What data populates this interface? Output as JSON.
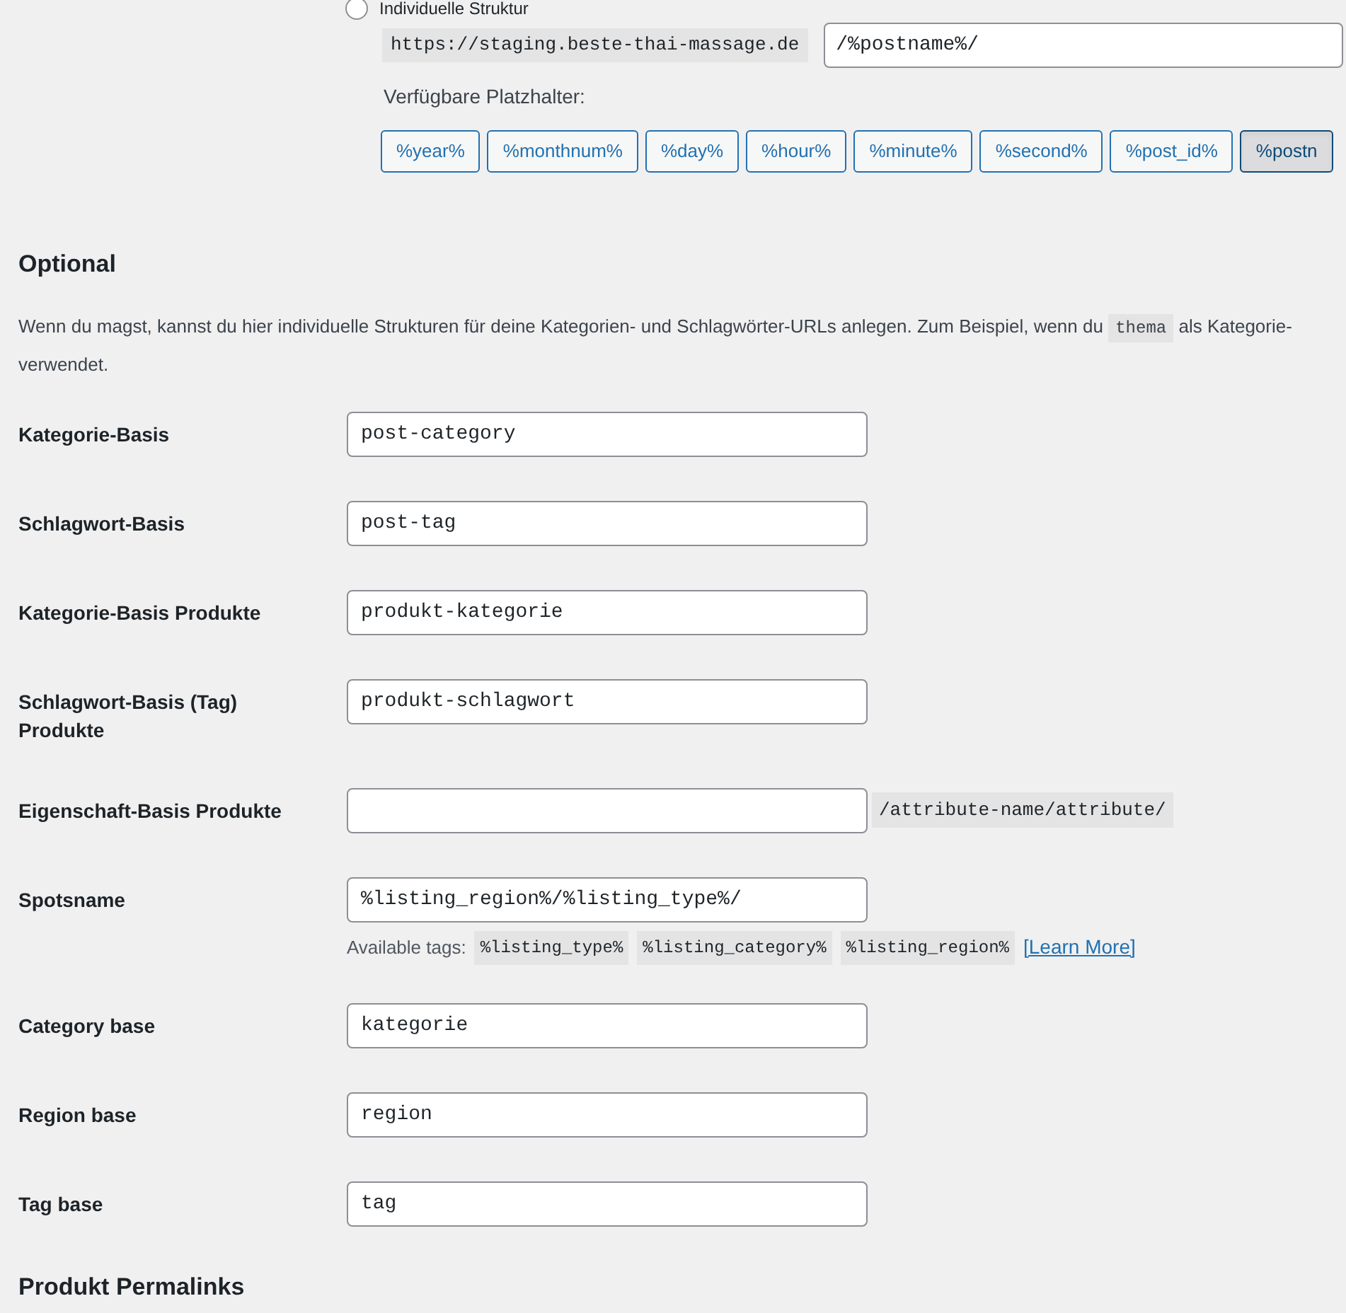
{
  "structure": {
    "radio_label": "Individuelle Struktur",
    "selected": false,
    "base_url": "https://staging.beste-thai-massage.de",
    "value": "/%postname%/",
    "placeholders_label": "Verfügbare Platzhalter:",
    "placeholders": [
      {
        "label": "%year%",
        "selected": false
      },
      {
        "label": "%monthnum%",
        "selected": false
      },
      {
        "label": "%day%",
        "selected": false
      },
      {
        "label": "%hour%",
        "selected": false
      },
      {
        "label": "%minute%",
        "selected": false
      },
      {
        "label": "%second%",
        "selected": false
      },
      {
        "label": "%post_id%",
        "selected": false
      },
      {
        "label": "%postn",
        "selected": true
      }
    ]
  },
  "optional": {
    "title": "Optional",
    "description": [
      {
        "kind": "text",
        "text": "Wenn du magst, kannst du hier individuelle Strukturen für deine Kategorien- und Schlagwörter-URLs anlegen. Zum Beispiel, wenn du"
      },
      {
        "kind": "code",
        "text": "thema"
      },
      {
        "kind": "text",
        "text": "als Kategorie-"
      },
      {
        "kind": "break"
      },
      {
        "kind": "text",
        "text": "verwendet."
      }
    ],
    "fields": [
      {
        "label": "Kategorie-Basis",
        "value": "post-category"
      },
      {
        "label": "Schlagwort-Basis",
        "value": "post-tag"
      },
      {
        "label": "Kategorie-Basis Produkte",
        "value": "produkt-kategorie"
      },
      {
        "label": "Schlagwort-Basis (Tag) Produkte",
        "value": "produkt-schlagwort"
      },
      {
        "label": "Eigenschaft-Basis Produkte",
        "suffix": "/attribute-name/attribute/"
      },
      {
        "label": "Spotsname",
        "value": "%listing_region%/%listing_type%/",
        "help": {
          "label": "Available tags:",
          "tags": [
            "%listing_type%",
            "%listing_category%",
            "%listing_region%"
          ],
          "link": "[Learn More]"
        }
      },
      {
        "label": "Category base",
        "value": "kategorie"
      },
      {
        "label": "Region base",
        "value": "region"
      },
      {
        "label": "Tag base",
        "value": "tag"
      }
    ]
  },
  "next_section": {
    "title": "Produkt Permalinks"
  }
}
